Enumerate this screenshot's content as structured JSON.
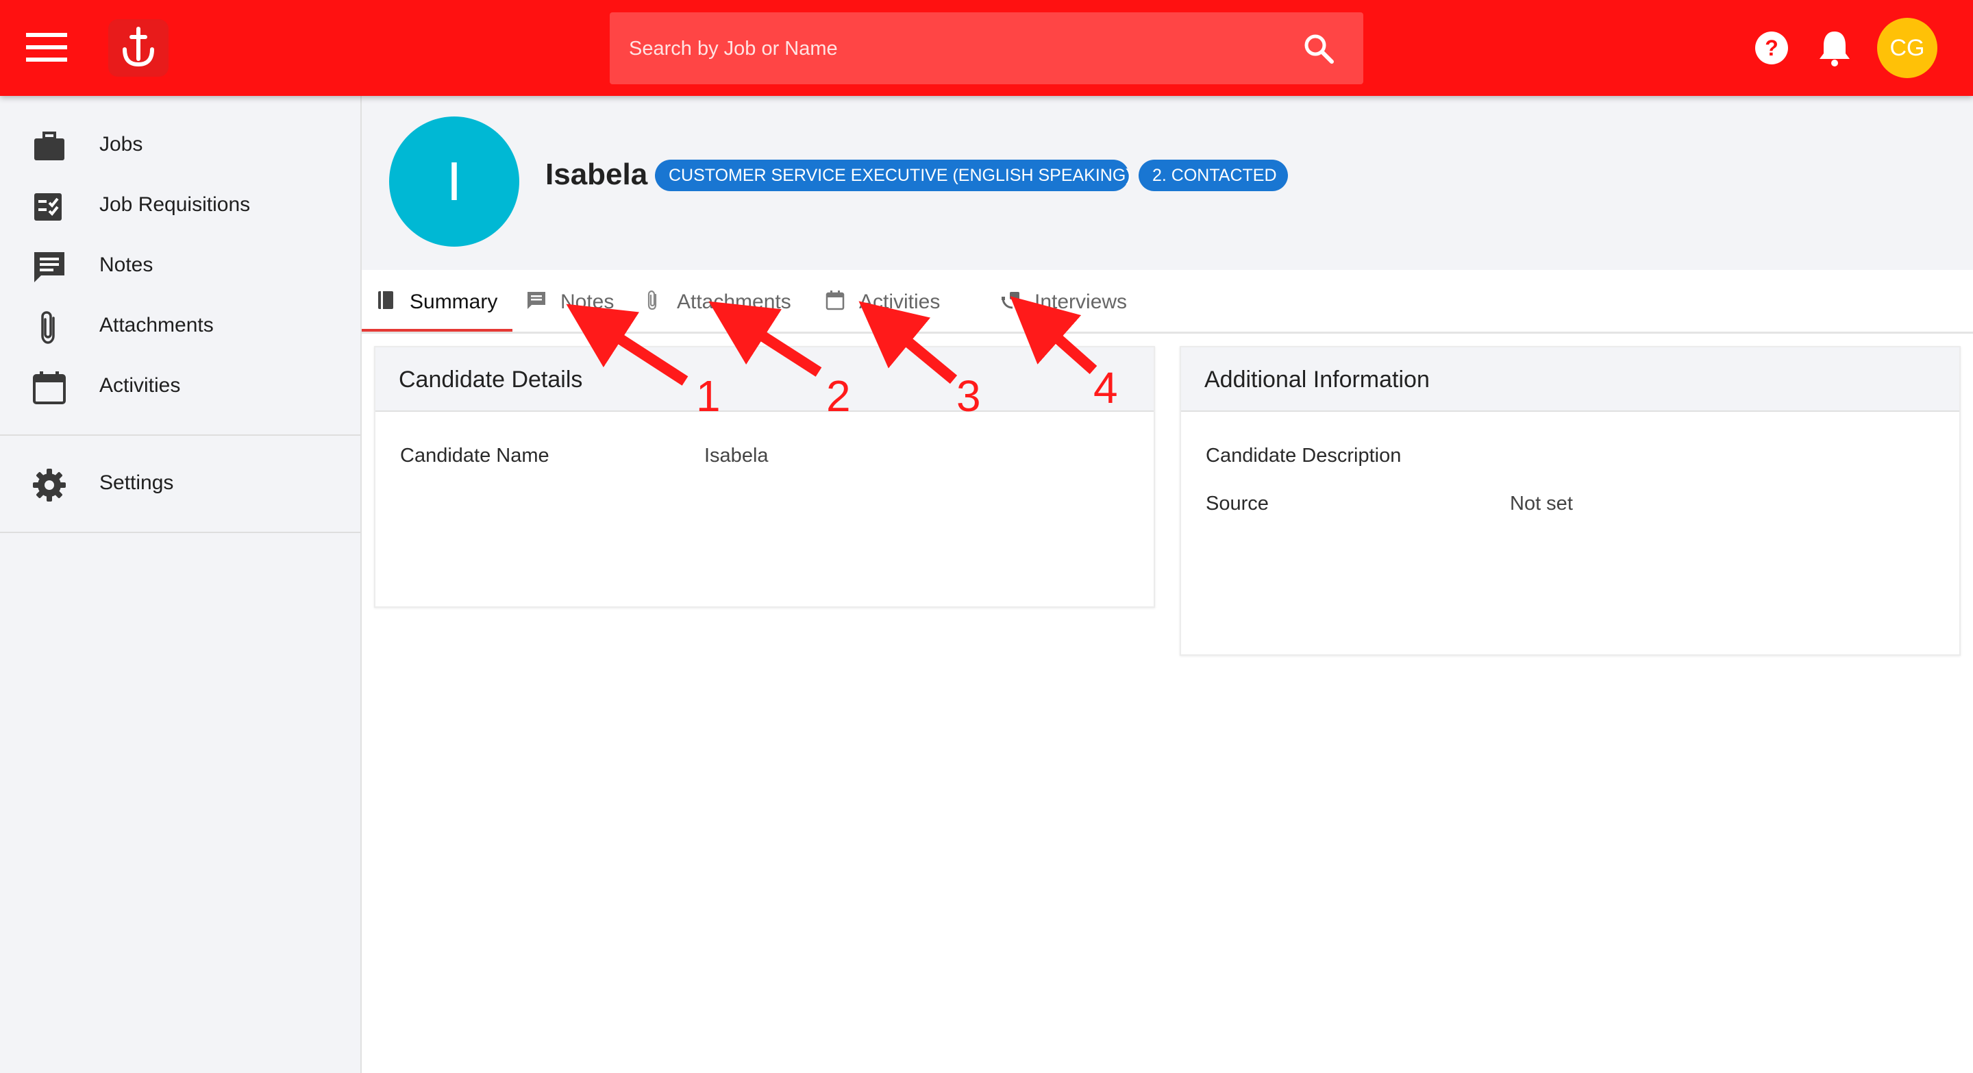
{
  "search": {
    "placeholder": "Search by Job or Name"
  },
  "user": {
    "initials": "CG"
  },
  "sidebar": {
    "items": [
      {
        "label": "Jobs",
        "icon": "briefcase-icon"
      },
      {
        "label": "Job Requisitions",
        "icon": "checklist-icon"
      },
      {
        "label": "Notes",
        "icon": "comment-icon"
      },
      {
        "label": "Attachments",
        "icon": "paperclip-icon"
      },
      {
        "label": "Activities",
        "icon": "calendar-icon"
      }
    ],
    "settings": {
      "label": "Settings",
      "icon": "gear-icon"
    }
  },
  "candidate": {
    "initial": "I",
    "name": "Isabela",
    "job_chip": "CUSTOMER SERVICE EXECUTIVE (ENGLISH SPEAKING)",
    "stage_chip": "2. CONTACTED"
  },
  "tabs": [
    {
      "label": "Summary",
      "icon": "book-icon",
      "active": true
    },
    {
      "label": "Notes",
      "icon": "comment-icon"
    },
    {
      "label": "Attachments",
      "icon": "paperclip-icon"
    },
    {
      "label": "Activities",
      "icon": "calendar-icon"
    },
    {
      "label": "Interviews",
      "icon": "interview-icon"
    }
  ],
  "candidate_details": {
    "title": "Candidate Details",
    "fields": [
      {
        "label": "Candidate Name",
        "value": "Isabela"
      }
    ]
  },
  "additional_info": {
    "title": "Additional Information",
    "fields": [
      {
        "label": "Candidate Description",
        "value": ""
      },
      {
        "label": "Source",
        "value": "Not set"
      }
    ]
  },
  "annotations": {
    "labels": [
      "1",
      "2",
      "3",
      "4"
    ],
    "color": "#ff1a1a"
  },
  "colors": {
    "topbar": "#ff1111",
    "accent": "#1976d2",
    "avatar_candidate": "#00b8d4",
    "avatar_user": "#ffc107"
  }
}
